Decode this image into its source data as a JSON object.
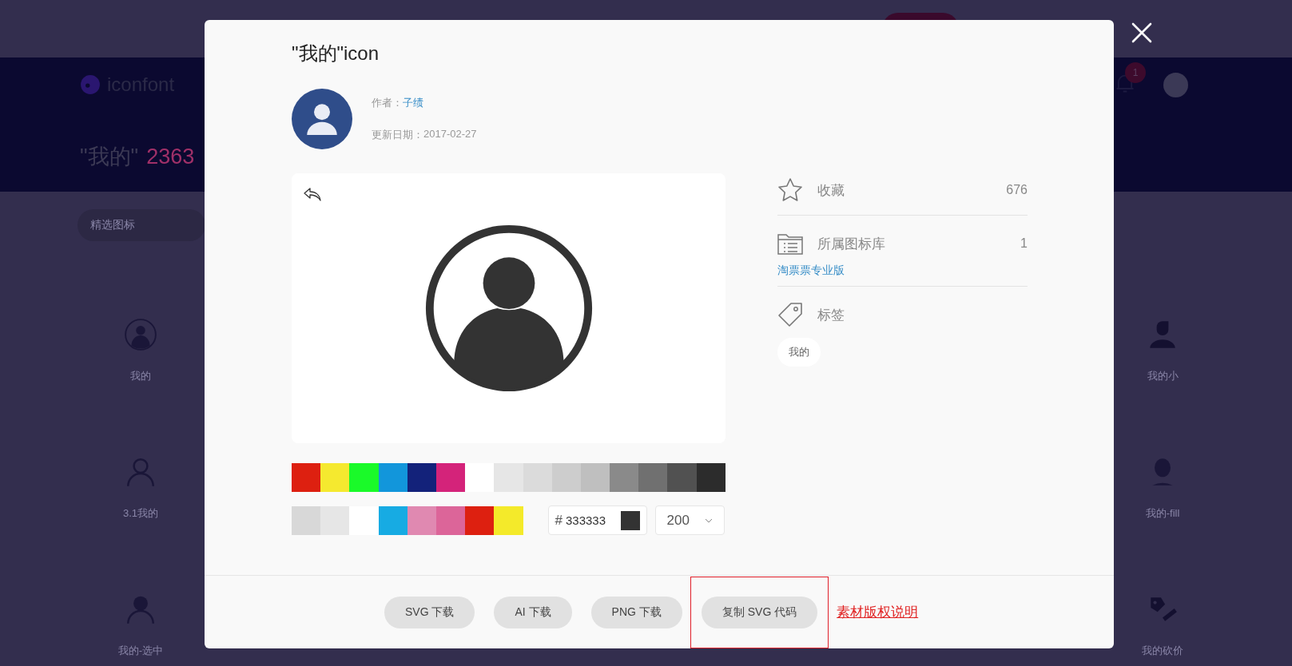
{
  "page": {
    "logo": "iconfont",
    "search_title": "\"我的\"",
    "result_count": "2363",
    "filter": "精选图标",
    "notification_count": "1",
    "left_icons": [
      {
        "label": "我的",
        "kind": "circle-user"
      },
      {
        "label": "3.1我的",
        "kind": "outline-user"
      },
      {
        "label": "我的-选中",
        "kind": "solid-user"
      }
    ],
    "right_icons": [
      {
        "label": "我的小",
        "kind": "drop-user"
      },
      {
        "label": "我的-fill",
        "kind": "fill-user"
      },
      {
        "label": "我的砍价",
        "kind": "tag"
      }
    ]
  },
  "modal": {
    "title": "\"我的\"icon",
    "author_label": "作者：",
    "author": "子绩",
    "date_label": "更新日期：",
    "date": "2017-02-27",
    "palette_row1": [
      {
        "color": "#dd2010"
      },
      {
        "color": "#f5e92f"
      },
      {
        "color": "#1afa29"
      },
      {
        "color": "#1296db"
      },
      {
        "color": "#13227a"
      },
      {
        "color": "#d4237a"
      },
      {
        "color": "#ffffff"
      },
      {
        "color": "#e6e6e6"
      },
      {
        "color": "#dbdbdb"
      },
      {
        "color": "#cdcdcd"
      },
      {
        "color": "#bfbfbf"
      },
      {
        "color": "#8a8a8a"
      },
      {
        "color": "#707070"
      },
      {
        "color": "#515151"
      },
      {
        "color": "#2c2c2c"
      }
    ],
    "palette_row2": [
      {
        "color": "#d8d8d8"
      },
      {
        "color": "#e6e6e6"
      },
      {
        "color": "#ffffff"
      },
      {
        "color": "#17abe3"
      },
      {
        "color": "#e089b1"
      },
      {
        "color": "#dc6599"
      },
      {
        "color": "#dd2010"
      },
      {
        "color": "#f4ea2a"
      }
    ],
    "hash": "#",
    "color_value": "333333",
    "size": "200",
    "stats": [
      {
        "kind": "star",
        "label": "收藏",
        "value": "676"
      },
      {
        "kind": "folder",
        "label": "所属图标库",
        "value": "1",
        "link": "淘票票专业版"
      },
      {
        "kind": "tag",
        "label": "标签",
        "tags": [
          "我的"
        ]
      }
    ],
    "buttons": [
      {
        "label": "SVG 下载",
        "highlighted": false
      },
      {
        "label": "AI 下载",
        "highlighted": false
      },
      {
        "label": "PNG 下载",
        "highlighted": false
      },
      {
        "label": "复制 SVG 代码",
        "highlighted": true
      }
    ],
    "copyright_link": "素材版权说明"
  }
}
